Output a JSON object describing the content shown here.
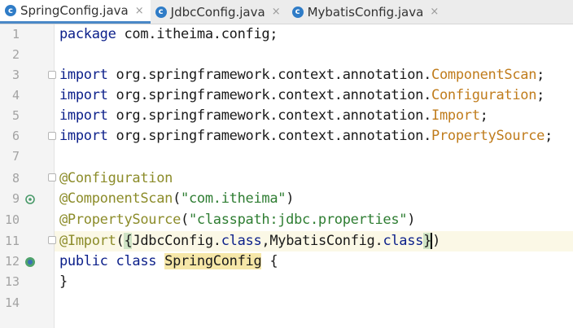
{
  "tabs": [
    {
      "label": "SpringConfig.java",
      "active": true
    },
    {
      "label": "JdbcConfig.java",
      "active": false
    },
    {
      "label": "MybatisConfig.java",
      "active": false
    }
  ],
  "close_glyph": "×",
  "lines": {
    "n1": "1",
    "n2": "2",
    "n3": "3",
    "n4": "4",
    "n5": "5",
    "n6": "6",
    "n7": "7",
    "n8": "8",
    "n9": "9",
    "n10": "10",
    "n11": "11",
    "n12": "12",
    "n13": "13",
    "n14": "14"
  },
  "code": {
    "l1_kw": "package",
    "l1_rest": " com.itheima.config;",
    "import_kw": "import",
    "pkg": " org.springframework.context.annotation.",
    "l3_cls": "ComponentScan",
    "l4_cls": "Configuration",
    "l5_cls": "Import",
    "l6_cls": "PropertySource",
    "semi": ";",
    "l8_ann": "@Configuration",
    "l9_ann": "@ComponentScan",
    "l9_str": "\"com.itheima\"",
    "l10_ann": "@PropertySource",
    "l10_str": "\"classpath:jdbc.properties\"",
    "l11_ann": "@Import",
    "l11_a": "JdbcConfig",
    "l11_b": "MybatisConfig",
    "class_kw": "class",
    "l12_kw1": "public",
    "l12_kw2": "class",
    "l12_name": "SpringConfig",
    "l12_brace": "{",
    "l13": "}"
  },
  "colors": {
    "accent": "#4a88c7",
    "keyword": "#0b1f8a",
    "class_ref": "#c07c1c",
    "annotation": "#8c8c2a",
    "string": "#2e7d32"
  }
}
